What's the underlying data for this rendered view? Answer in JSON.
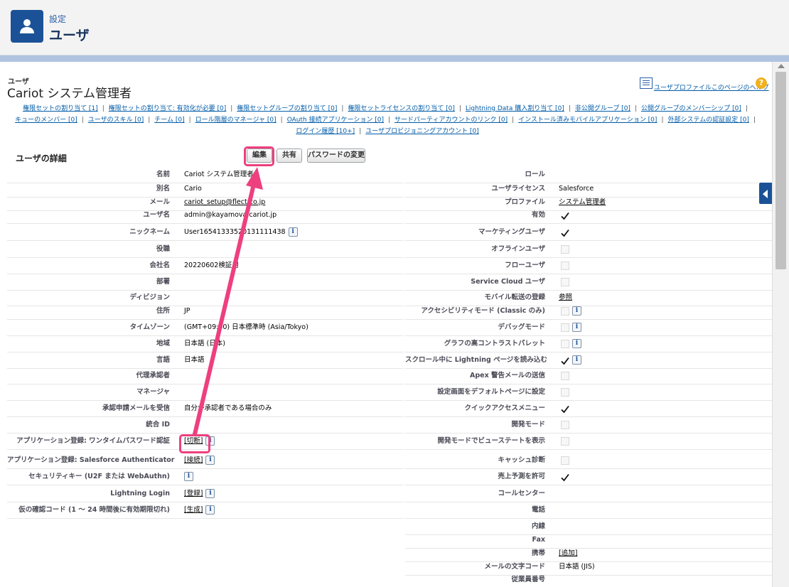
{
  "header": {
    "breadcrumb": "設定",
    "title": "ユーザ"
  },
  "object": {
    "label": "ユーザ",
    "name": "Cariot システム管理者"
  },
  "help": {
    "link": "ユーザプロファイルこのページのヘルプ",
    "icon": "help-question-icon"
  },
  "related_links": {
    "line1": [
      "権限セットの割り当て [1]",
      "権限セットの割り当て: 有効化が必要 [0]",
      "権限セットグループの割り当て [0]",
      "権限セットライセンスの割り当て [0]",
      "Lightning Data 購入割り当て [0]",
      "非公開グループ [0]",
      "公開グループのメンバーシップ [0]"
    ],
    "line2": [
      "キューのメンバー [0]",
      "ユーザのスキル [0]",
      "チーム [0]",
      "ロール階層のマネージャ [0]",
      "OAuth 接続アプリケーション [0]",
      "サードパーティアカウントのリンク [0]",
      "インストール済みモバイルアプリケーション [0]",
      "外部システムの認証設定 [0]"
    ],
    "line3": [
      "ログイン履歴 [10+]",
      "ユーザプロビジョニングアカウント [0]"
    ]
  },
  "section": {
    "title": "ユーザの詳細",
    "edit_label": "編集",
    "share_label": "共有",
    "password_label": "パスワードの変更"
  },
  "left_fields": {
    "name": {
      "label": "名前",
      "value": "Cariot システム管理者"
    },
    "alias": {
      "label": "別名",
      "value": "Cario"
    },
    "email": {
      "label": "メール",
      "value": "cariot_setup@flect.co.jp"
    },
    "username": {
      "label": "ユーザ名",
      "value": "admin@kayamova.cariot.jp"
    },
    "nickname": {
      "label": "ニックネーム",
      "value": "User16541333520131111438"
    },
    "title": {
      "label": "役職",
      "value": ""
    },
    "company": {
      "label": "会社名",
      "value": "20220602検証用"
    },
    "department": {
      "label": "部署",
      "value": ""
    },
    "division": {
      "label": "ディビジョン",
      "value": ""
    },
    "address": {
      "label": "住所",
      "value": "JP"
    },
    "timezone": {
      "label": "タイムゾーン",
      "value": "(GMT+09:00) 日本標準時 (Asia/Tokyo)"
    },
    "locale": {
      "label": "地域",
      "value": "日本語 (日本)"
    },
    "language": {
      "label": "言語",
      "value": "日本語"
    },
    "delegated_approver": {
      "label": "代理承認者",
      "value": ""
    },
    "manager": {
      "label": "マネージャ",
      "value": ""
    },
    "approval_email": {
      "label": "承認申請メールを受信",
      "value": "自分が承認者である場合のみ"
    },
    "federation_id": {
      "label": "統合 ID",
      "value": ""
    },
    "app_otp": {
      "label": "アプリケーション登録: ワンタイムパスワード認証",
      "value": "[切断]"
    },
    "app_sfauth": {
      "label": "アプリケーション登録: Salesforce Authenticator",
      "value": "[接続]"
    },
    "security_key": {
      "label": "セキュリティキー (U2F または WebAuthn)",
      "value": ""
    },
    "lightning_login": {
      "label": "Lightning Login",
      "value": "[登録]"
    },
    "temp_code": {
      "label": "仮の確認コード (1 ～ 24 時間後に有効期限切れ)",
      "value": "[生成]"
    }
  },
  "right_fields": {
    "role": {
      "label": "ロール",
      "value": ""
    },
    "user_license": {
      "label": "ユーザライセンス",
      "value": "Salesforce"
    },
    "profile": {
      "label": "プロファイル",
      "value": "システム管理者"
    },
    "active": {
      "label": "有効",
      "checked": true
    },
    "marketing_user": {
      "label": "マーケティングユーザ",
      "checked": true
    },
    "offline_user": {
      "label": "オフラインユーザ",
      "checked": false
    },
    "flow_user": {
      "label": "フローユーザ",
      "checked": false
    },
    "service_cloud_user": {
      "label": "Service Cloud ユーザ",
      "checked": false
    },
    "mobile_push": {
      "label": "モバイル転送の登録",
      "value": "参照"
    },
    "accessibility": {
      "label": "アクセシビリティモード (Classic のみ)",
      "checked": false
    },
    "debug_mode": {
      "label": "デバッグモード",
      "checked": false
    },
    "high_contrast": {
      "label": "グラフの高コントラストパレット",
      "checked": false
    },
    "scroll_lightning": {
      "label": "スクロール中に Lightning ページを読み込む",
      "checked": true
    },
    "apex_email": {
      "label": "Apex 警告メールの送信",
      "checked": false
    },
    "setup_default": {
      "label": "設定画面をデフォルトページに設定",
      "checked": false
    },
    "quick_access": {
      "label": "クイックアクセスメニュー",
      "checked": true
    },
    "dev_mode": {
      "label": "開発モード",
      "checked": false
    },
    "viewstate": {
      "label": "開発モードでビューステートを表示",
      "checked": false
    },
    "cache_diag": {
      "label": "キャッシュ診断",
      "checked": false
    },
    "forecast": {
      "label": "売上予測を許可",
      "checked": true
    },
    "call_center": {
      "label": "コールセンター",
      "value": ""
    },
    "phone": {
      "label": "電話",
      "value": ""
    },
    "extension": {
      "label": "内線",
      "value": ""
    },
    "fax": {
      "label": "Fax",
      "value": ""
    },
    "mobile": {
      "label": "携帯",
      "value": "[追加]"
    },
    "email_encoding": {
      "label": "メールの文字コード",
      "value": "日本語 (JIS)"
    },
    "employee_number": {
      "label": "従業員番号",
      "value": ""
    }
  },
  "icons": {
    "avatar": "user-avatar-icon",
    "info": "info-icon",
    "check": "checkmark-icon",
    "collapse": "chevron-left-icon"
  },
  "colors": {
    "header_tile": "#1b5297",
    "highlight": "#ee3f7e",
    "link": "#015ba7"
  }
}
